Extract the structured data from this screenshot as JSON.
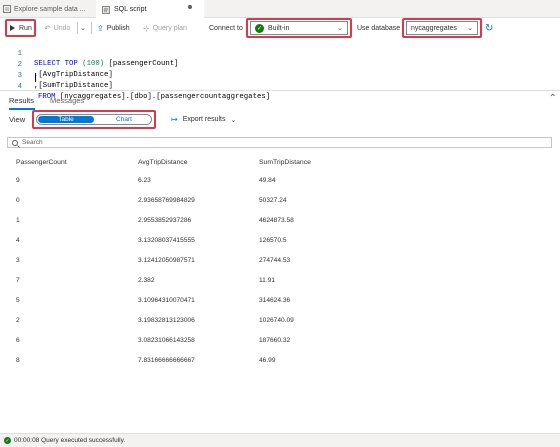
{
  "tabs": [
    {
      "label": "Explore sample data ...",
      "icon": "notebook-icon"
    },
    {
      "label": "SQL script",
      "icon": "sql-script-icon"
    }
  ],
  "toolbar": {
    "run_label": "Run",
    "undo_label": "Undo",
    "publish_label": "Publish",
    "query_plan_label": "Query plan",
    "connect_to_label": "Connect to",
    "connect_value": "Built-in",
    "use_database_label": "Use database",
    "database_value": "nycaggregates"
  },
  "editor": {
    "lines": [
      {
        "num": "1",
        "kw": "SELECT TOP",
        "num_lit": "(100)",
        "rest": " [passengerCount]"
      },
      {
        "num": "2",
        "text": ",[AvgTripDistance]"
      },
      {
        "num": "3",
        "text": ",[SumTripDistance]"
      },
      {
        "num": "4",
        "kw": "FROM",
        "rest": " [nycaggregates].[dbo].[passengercountaggregates]"
      }
    ]
  },
  "results": {
    "tab_results": "Results",
    "tab_messages": "Messages",
    "view_label": "View",
    "view_table": "Table",
    "view_chart": "Chart",
    "export_label": "Export results",
    "search_placeholder": "Search",
    "columns": [
      "PassengerCount",
      "AvgTripDistance",
      "SumTripDistance"
    ],
    "rows": [
      [
        "9",
        "6.23",
        "49.84"
      ],
      [
        "0",
        "2.93658769984829",
        "50327.24"
      ],
      [
        "1",
        "2.9553852937286",
        "4624873.58"
      ],
      [
        "4",
        "3.13208037415555",
        "126570.5"
      ],
      [
        "3",
        "3.12412050987571",
        "274744.53"
      ],
      [
        "7",
        "2.382",
        "11.91"
      ],
      [
        "5",
        "3.10964310070471",
        "314624.36"
      ],
      [
        "2",
        "3.19832813123006",
        "1026740.09"
      ],
      [
        "6",
        "3.08231066143258",
        "187660.32"
      ],
      [
        "8",
        "7.83166666666667",
        "46.99"
      ]
    ]
  },
  "status": {
    "text": "00:00:08 Query executed successfully."
  },
  "colors": {
    "accent": "#0078d4",
    "highlight": "#d9394a",
    "success": "#107c10"
  }
}
